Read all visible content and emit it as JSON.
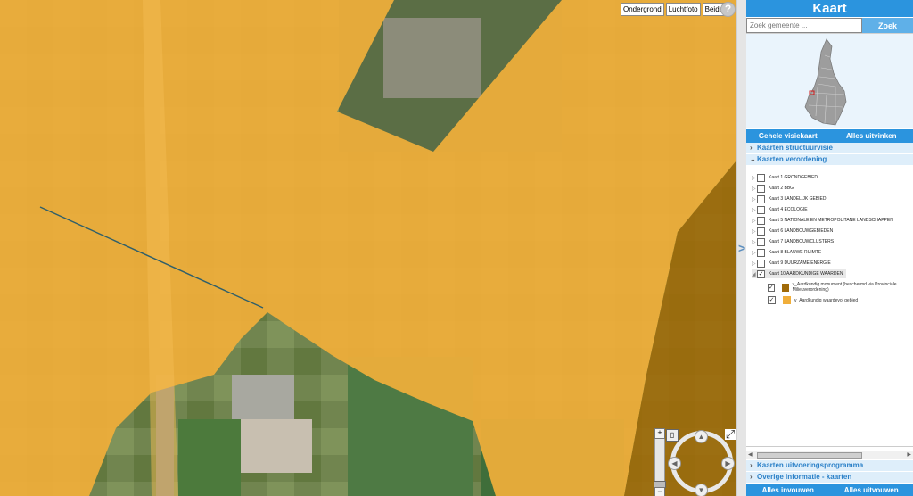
{
  "map": {
    "basemap_buttons": [
      "Ondergrond",
      "Luchtfoto",
      "Beide"
    ],
    "help_label": "?"
  },
  "panel": {
    "title": "Kaart",
    "search": {
      "placeholder": "Zoek gemeente ...",
      "button": "Zoek"
    },
    "overview_buttons": [
      "Gehele visiekaart",
      "Alles uitvinken"
    ],
    "sections": {
      "structuurvisie": "Kaarten structuurvisie",
      "verordening": "Kaarten verordening",
      "uitvoeringsprogramma": "Kaarten uitvoeringsprogramma",
      "overige": "Overige informatie - kaarten"
    },
    "kaarten": [
      {
        "label": "Kaart 1 GRONDGEBIED",
        "checked": false
      },
      {
        "label": "Kaart 2 BBG",
        "checked": false
      },
      {
        "label": "Kaart 3 LANDELIJK GEBIED",
        "checked": false
      },
      {
        "label": "Kaart 4 ECOLOGIE",
        "checked": false
      },
      {
        "label": "Kaart 5 NATIONALE EN METROPOLITANE LANDSCHAPPEN",
        "checked": false
      },
      {
        "label": "Kaart 6 LANDBOUWGEBIEDEN",
        "checked": false
      },
      {
        "label": "Kaart 7 LANDBOUWCLUSTERS",
        "checked": false
      },
      {
        "label": "Kaart 8 BLAUWE RUIMTE",
        "checked": false
      },
      {
        "label": "Kaart 9 DUURZAME ENERGIE",
        "checked": false
      },
      {
        "label": "Kaart 10 AARDKUNDIGE WAARDEN",
        "checked": true
      }
    ],
    "legend": [
      {
        "label": "v_Aardkundig monument (beschermd via Provinciale Milieuverordening)",
        "color": "#a06a08"
      },
      {
        "label": "v_Aardkundig waardevol gebied",
        "color": "#f0ae3a"
      }
    ],
    "bottom_buttons": [
      "Alles invouwen",
      "Alles uitvouwen"
    ]
  },
  "colors": {
    "accent": "#2b94de",
    "aardkundig_waardevol": "#f0ae3a",
    "aardkundig_monument": "#a06a08"
  }
}
